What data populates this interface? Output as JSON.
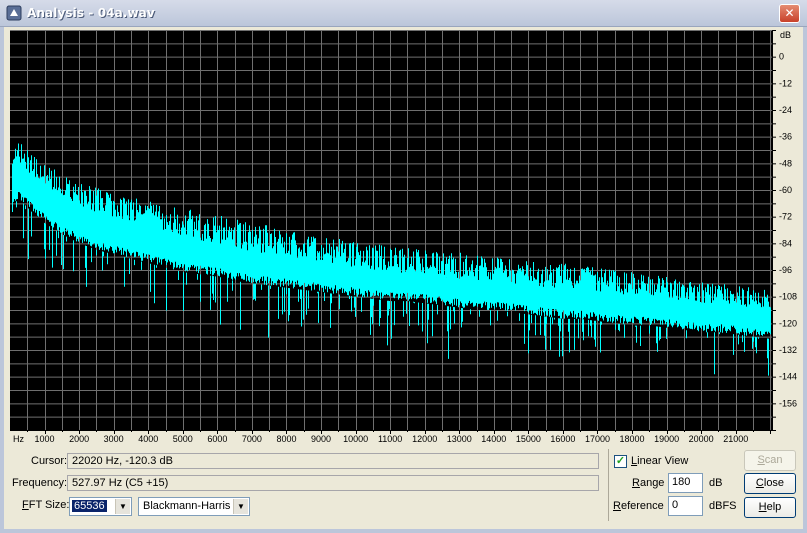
{
  "window": {
    "title": "Analysis - 04a.wav",
    "close_glyph": "✕"
  },
  "chart_data": {
    "type": "area",
    "title": "",
    "xlabel": "",
    "ylabel": "dB",
    "x_unit_label": "Hz",
    "xticks": [
      "1000",
      "2000",
      "3000",
      "4000",
      "5000",
      "6000",
      "7000",
      "8000",
      "9000",
      "10000",
      "11000",
      "12000",
      "13000",
      "14000",
      "15000",
      "16000",
      "17000",
      "18000",
      "19000",
      "20000",
      "21000"
    ],
    "yticks": [
      "0",
      "-12",
      "-24",
      "-36",
      "-48",
      "-60",
      "-72",
      "-84",
      "-96",
      "-108",
      "-120",
      "-132",
      "-144",
      "-156"
    ],
    "xlim": [
      0,
      22050
    ],
    "ylim": [
      -168,
      12
    ],
    "grid": true,
    "scale": "linear",
    "series": [
      {
        "color": "#00ffff",
        "x": [
          0,
          100,
          250,
          500,
          750,
          1000,
          1500,
          2000,
          2500,
          3000,
          3500,
          4000,
          4500,
          5000,
          5500,
          6000,
          6500,
          7000,
          7500,
          8000,
          8500,
          9000,
          9500,
          10000,
          10500,
          11000,
          11500,
          12000,
          12500,
          13000,
          13500,
          14000,
          14500,
          15000,
          15500,
          16000,
          16500,
          17000,
          17500,
          18000,
          18500,
          19000,
          19500,
          20000,
          20500,
          21000,
          21500,
          22000
        ],
        "peak": [
          -58,
          -40,
          -38,
          -40,
          -45,
          -48,
          -53,
          -57,
          -59,
          -61,
          -63,
          -65,
          -67,
          -68,
          -70,
          -71,
          -73,
          -75,
          -76,
          -78,
          -80,
          -81,
          -82,
          -83,
          -84,
          -85,
          -86,
          -87,
          -88,
          -88,
          -89,
          -90,
          -91,
          -92,
          -93,
          -93,
          -94,
          -95,
          -96,
          -97,
          -98,
          -99,
          -100,
          -101,
          -102,
          -103,
          -104,
          -105
        ],
        "upper": [
          -66,
          -50,
          -48,
          -52,
          -56,
          -59,
          -64,
          -67,
          -70,
          -72,
          -75,
          -77,
          -79,
          -81,
          -83,
          -84,
          -86,
          -88,
          -89,
          -90,
          -91,
          -92,
          -94,
          -95,
          -96,
          -97,
          -98,
          -98,
          -99,
          -100,
          -101,
          -101,
          -102,
          -103,
          -104,
          -104,
          -105,
          -106,
          -107,
          -107,
          -108,
          -109,
          -110,
          -111,
          -111,
          -112,
          -113,
          -114
        ],
        "lower": [
          -80,
          -66,
          -64,
          -68,
          -72,
          -75,
          -80,
          -84,
          -87,
          -89,
          -91,
          -93,
          -95,
          -97,
          -98,
          -99,
          -101,
          -102,
          -103,
          -104,
          -105,
          -106,
          -107,
          -108,
          -109,
          -110,
          -110,
          -111,
          -112,
          -113,
          -114,
          -114,
          -115,
          -116,
          -117,
          -118,
          -118,
          -119,
          -120,
          -121,
          -121,
          -122,
          -123,
          -124,
          -124,
          -125,
          -126,
          -127
        ],
        "dips": [
          -100,
          -96,
          -95,
          -99,
          -103,
          -104,
          -109,
          -113,
          -115,
          -117,
          -119,
          -120,
          -122,
          -123,
          -124,
          -124,
          -126,
          -127,
          -128,
          -129,
          -130,
          -131,
          -132,
          -132,
          -133,
          -134,
          -134,
          -135,
          -136,
          -137,
          -137,
          -138,
          -138,
          -139,
          -140,
          -140,
          -141,
          -141,
          -142,
          -142,
          -143,
          -144,
          -144,
          -145,
          -145,
          -146,
          -147,
          -148
        ]
      }
    ]
  },
  "form": {
    "cursor_label": "Cursor:",
    "cursor_value": "22020 Hz, -120.3 dB",
    "frequency_label": "Frequency:",
    "frequency_value": "527.97 Hz (C5 +15)",
    "fft_label": "FFT Size:",
    "fft_value": "65536",
    "window_func": "Blackmann-Harris",
    "linear_view_label": "Linear View",
    "linear_view_checked": true,
    "range_label": "Range",
    "range_value": "180",
    "range_unit": "dB",
    "reference_label": "Reference",
    "reference_value": "0",
    "reference_unit": "dBFS",
    "scan_button": "Scan",
    "close_button": "Close",
    "help_button": "Help"
  }
}
